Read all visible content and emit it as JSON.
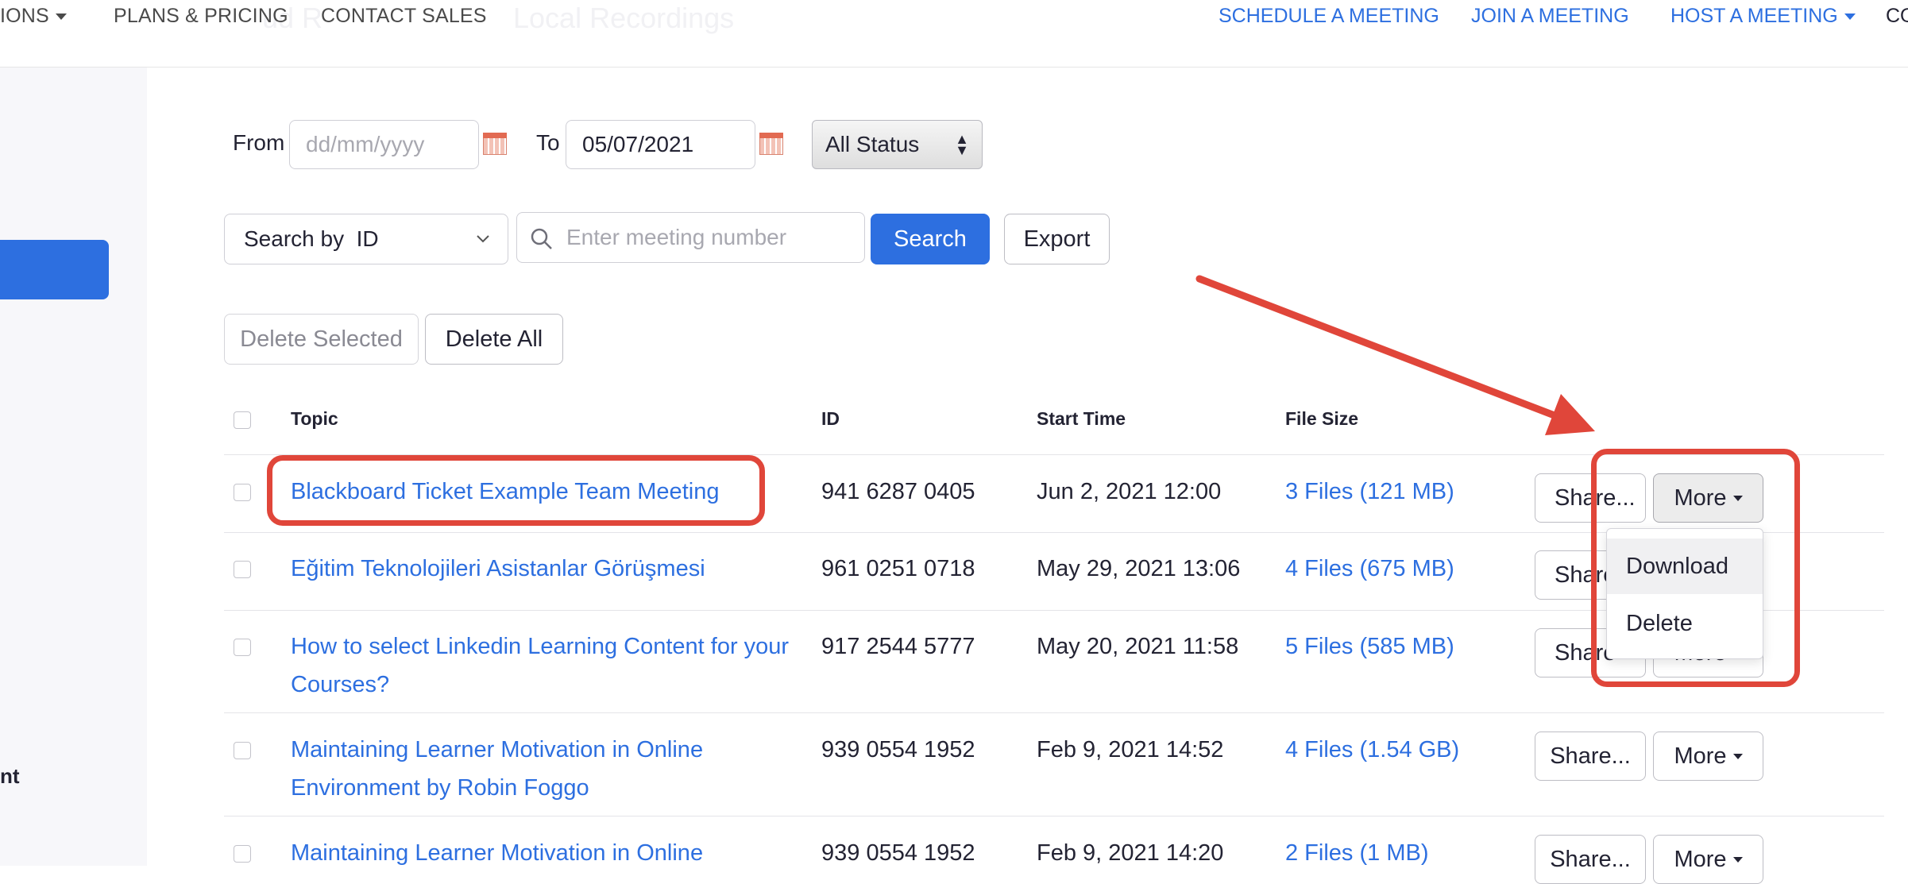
{
  "nav": {
    "left_items": [
      {
        "label": "IONS",
        "has_caret": true
      },
      {
        "label": "PLANS & PRICING"
      },
      {
        "label": "CONTACT SALES"
      }
    ],
    "background_tab_fragments": [
      "ud R",
      "Local Recordings"
    ],
    "right_items": [
      {
        "label": "SCHEDULE A MEETING"
      },
      {
        "label": "JOIN A MEETING"
      },
      {
        "label": "HOST A MEETING",
        "has_caret": true
      }
    ],
    "edge_fragment": "CO"
  },
  "sidebar": {
    "bottom_fragment": "nt"
  },
  "filters": {
    "from_label": "From",
    "from_placeholder": "dd/mm/yyyy",
    "to_label": "To",
    "to_value": "05/07/2021",
    "status_selected": "All Status",
    "search_by_label": "Search by  ID",
    "search_placeholder": "Enter meeting number",
    "search_button": "Search",
    "export_button": "Export"
  },
  "actions": {
    "delete_selected": "Delete Selected",
    "delete_all": "Delete All"
  },
  "table": {
    "headers": [
      "Topic",
      "ID",
      "Start Time",
      "File Size"
    ],
    "rows": [
      {
        "topic": [
          "Blackboard Ticket Example Team Meeting"
        ],
        "id": "941 6287 0405",
        "start_time": "Jun 2, 2021 12:00",
        "file_size": "3 Files (121 MB)"
      },
      {
        "topic": [
          "Eğitim Teknolojileri Asistanlar Görüşmesi"
        ],
        "id": "961 0251 0718",
        "start_time": "May 29, 2021 13:06",
        "file_size": "4 Files (675 MB)"
      },
      {
        "topic": [
          "How to select Linkedin Learning Content for your",
          "Courses?"
        ],
        "id": "917 2544 5777",
        "start_time": "May 20, 2021 11:58",
        "file_size": "5 Files (585 MB)"
      },
      {
        "topic": [
          "Maintaining Learner Motivation in Online",
          "Environment by Robin Foggo"
        ],
        "id": "939 0554 1952",
        "start_time": "Feb 9, 2021 14:52",
        "file_size": "4 Files (1.54 GB)"
      },
      {
        "topic": [
          "Maintaining Learner Motivation in Online"
        ],
        "id": "939 0554 1952",
        "start_time": "Feb 9, 2021 14:20",
        "file_size": "2 Files (1 MB)"
      }
    ],
    "share_label": "Share...",
    "share_label_occluded": "Share",
    "more_label": "More"
  },
  "more_menu": {
    "items": [
      "Download",
      "Delete"
    ]
  },
  "colors": {
    "accent": "#2d6fe0",
    "annotation": "#e0463a"
  }
}
